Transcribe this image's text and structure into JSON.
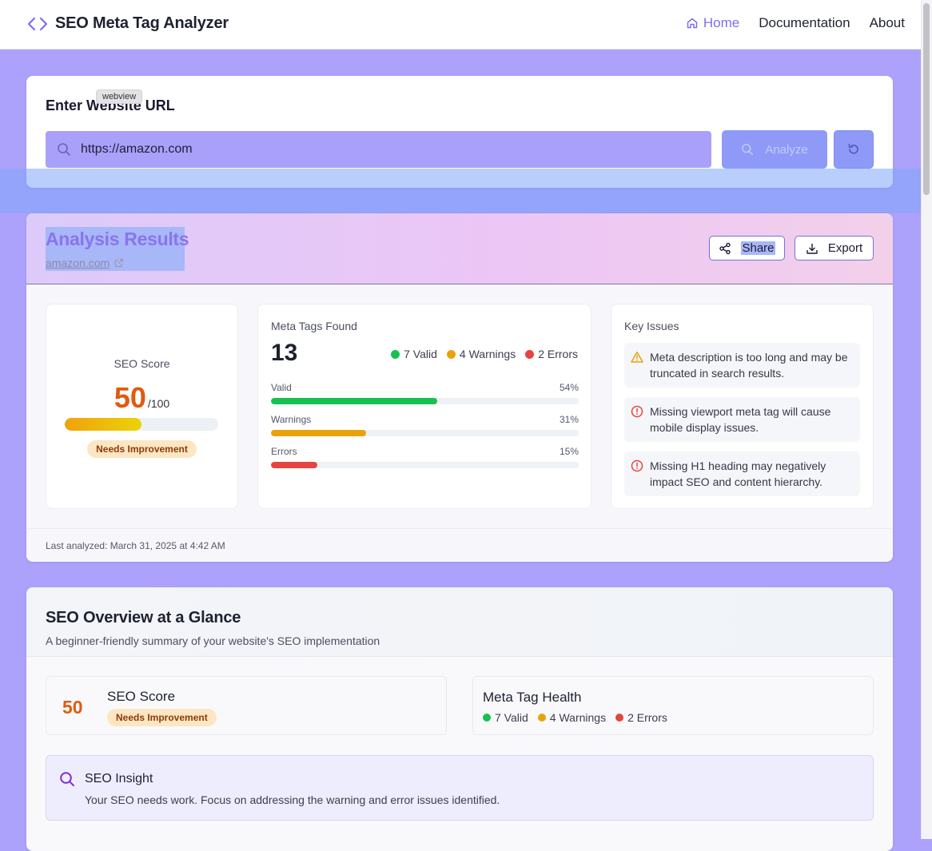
{
  "header": {
    "title": "SEO Meta Tag Analyzer",
    "nav": [
      {
        "label": "Home",
        "active": true
      },
      {
        "label": "Documentation"
      },
      {
        "label": "About"
      }
    ]
  },
  "url_form": {
    "title": "Enter Website URL",
    "tooltip": "webview",
    "url_value": "https://amazon.com",
    "analyze_label": "Analyze"
  },
  "results": {
    "title": "Analysis Results",
    "domain": "amazon.com",
    "share_label": "Share",
    "export_label": "Export",
    "score": {
      "label": "SEO Score",
      "value": "50",
      "max": "/100",
      "fraction": 0.5,
      "status": "Needs Improvement"
    },
    "meta": {
      "title": "Meta Tags Found",
      "count": "13",
      "legend": {
        "valid": "7 Valid",
        "warnings": "4 Warnings",
        "errors": "2 Errors"
      },
      "bars": [
        {
          "label": "Valid",
          "percent": "54%",
          "value": 54,
          "color": "#16c150"
        },
        {
          "label": "Warnings",
          "percent": "31%",
          "value": 31,
          "color": "#e8a30b"
        },
        {
          "label": "Errors",
          "percent": "15%",
          "value": 15,
          "color": "#e5453f"
        }
      ]
    },
    "issues": {
      "title": "Key Issues",
      "items": [
        {
          "icon": "warning-icon",
          "text": "Meta description is too long and may be truncated in search results."
        },
        {
          "icon": "error-icon",
          "text": "Missing viewport meta tag will cause mobile display issues."
        },
        {
          "icon": "error-icon",
          "text": "Missing H1 heading may negatively impact SEO and content hierarchy."
        }
      ]
    },
    "last_analyzed": "Last analyzed: March 31, 2025 at 4:42 AM"
  },
  "overview": {
    "title": "SEO Overview at a Glance",
    "subtitle": "A beginner-friendly summary of your website's SEO implementation",
    "score_value": "50",
    "score_label": "SEO Score",
    "score_status": "Needs Improvement",
    "health_label": "Meta Tag Health",
    "health": {
      "valid": "7 Valid",
      "warnings": "4 Warnings",
      "errors": "2 Errors"
    },
    "insight_title": "SEO Insight",
    "insight_text": "Your SEO needs work. Focus on addressing the warning and error issues identified."
  },
  "colors": {
    "accent": "#7c6ff0",
    "background": "#ada2fb",
    "score_orange": "#e15a10",
    "valid": "#16c150",
    "warning": "#e8a30b",
    "error": "#e5453f"
  }
}
